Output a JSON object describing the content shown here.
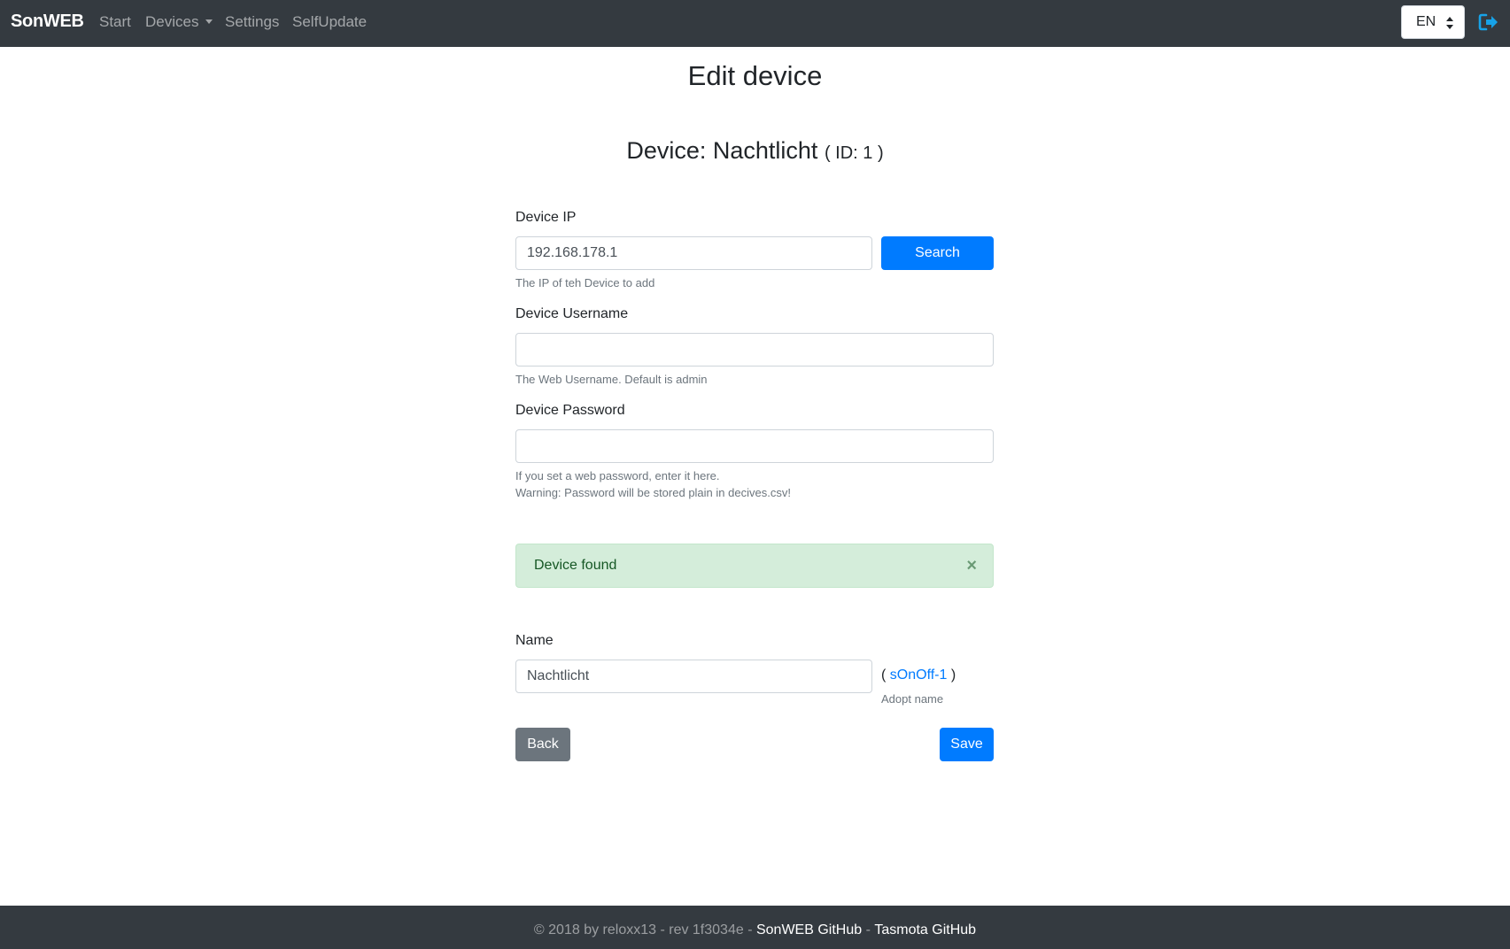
{
  "navbar": {
    "brand": "SonWEB",
    "items": [
      "Start",
      "Devices",
      "Settings",
      "SelfUpdate"
    ],
    "language": "EN",
    "logout_icon": "logout-icon"
  },
  "page": {
    "title": "Edit device",
    "device_heading": "Device: Nachtlicht",
    "device_id": "( ID: 1 )"
  },
  "form": {
    "ip": {
      "label": "Device IP",
      "value": "192.168.178.1",
      "help": "The IP of teh Device to add",
      "search_button": "Search"
    },
    "username": {
      "label": "Device Username",
      "value": "",
      "help": "The Web Username. Default is admin"
    },
    "password": {
      "label": "Device Password",
      "value": "",
      "help_line1": "If you set a web password, enter it here.",
      "help_line2": "Warning: Password will be stored plain in decives.csv!"
    },
    "alert": {
      "text": "Device found",
      "close": "×"
    },
    "name": {
      "label": "Name",
      "value": "Nachtlicht",
      "adopt_open": "(",
      "adopt_link": "sOnOff-1",
      "adopt_close": ")",
      "adopt_help": "Adopt name"
    },
    "back_button": "Back",
    "save_button": "Save"
  },
  "footer": {
    "text": "© 2018 by reloxx13 - rev 1f3034e - ",
    "link1": "SonWEB GitHub",
    "separator": " - ",
    "link2": "Tasmota GitHub"
  },
  "colors": {
    "navbar_bg": "#343a40",
    "primary": "#007bff",
    "secondary": "#6c757d",
    "success_bg": "#d4edda",
    "success_text": "#155724"
  }
}
